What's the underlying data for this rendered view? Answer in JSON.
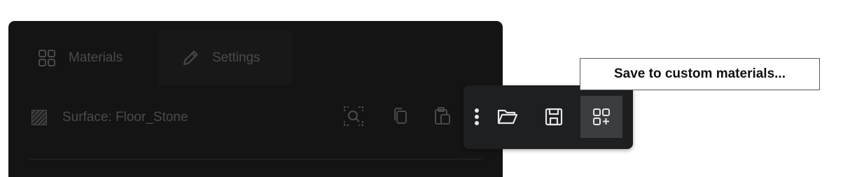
{
  "panel": {
    "tabs": [
      {
        "label": "Materials",
        "icon": "grid-icon",
        "active": false
      },
      {
        "label": "Settings",
        "icon": "pencil-icon",
        "active": true
      }
    ],
    "surface_label": "Surface: Floor_Stone",
    "row_icons": [
      "zoom-fit-icon",
      "copy-icon",
      "paste-icon"
    ]
  },
  "toolbar": {
    "buttons": [
      "more-options-icon",
      "open-folder-icon",
      "save-icon",
      "add-to-grid-icon"
    ],
    "highlighted": "add-to-grid-icon"
  },
  "tooltip": {
    "text": "Save to custom materials..."
  },
  "colors": {
    "panel_bg": "#141414",
    "toolbar_bg": "#1e1f21",
    "highlight_bg": "#3c3d3f",
    "dim_text": "#4a4a4a",
    "icon_light": "#e6e6e6"
  }
}
